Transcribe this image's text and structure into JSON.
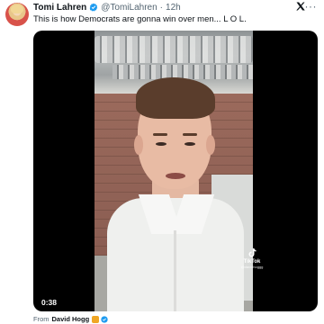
{
  "tweet": {
    "display_name": "Tomi Lahren",
    "handle": "@TomiLahren",
    "separator": "·",
    "time": "12h",
    "more_label": "···",
    "text": "This is how Democrats are gonna win over men... L O L."
  },
  "video": {
    "duration": "0:38",
    "watermark_label": "TikTok",
    "watermark_handle": "@davidhoggg"
  },
  "attribution": {
    "prefix": "From",
    "name": "David Hogg"
  },
  "colors": {
    "verified": "#1d9bf0",
    "secondary_text": "#536471",
    "badge": "#f0a624"
  },
  "icons": [
    "avatar",
    "verified-badge-icon",
    "x-logo-icon",
    "more-icon",
    "tiktok-icon",
    "affiliate-badge-icon"
  ]
}
